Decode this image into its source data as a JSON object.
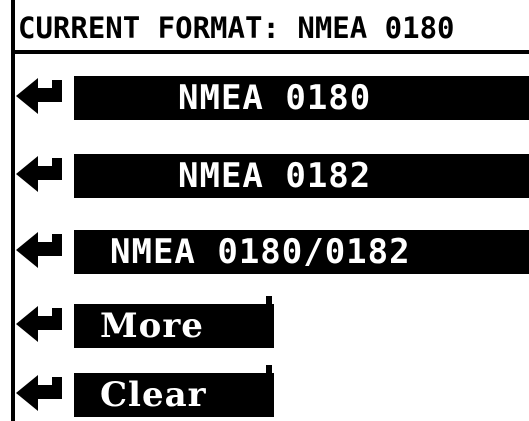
{
  "header": {
    "label": "CURRENT FORMAT:",
    "value": "NMEA 0180"
  },
  "menu": {
    "items": [
      {
        "label": "NMEA 0180"
      },
      {
        "label": "NMEA 0182"
      },
      {
        "label": "NMEA 0180/0182"
      },
      {
        "label": "More"
      },
      {
        "label": "Clear"
      }
    ]
  },
  "icons": {
    "enter": "enter-arrow-icon"
  },
  "colors": {
    "background": "#ffffff",
    "foreground": "#000000"
  }
}
